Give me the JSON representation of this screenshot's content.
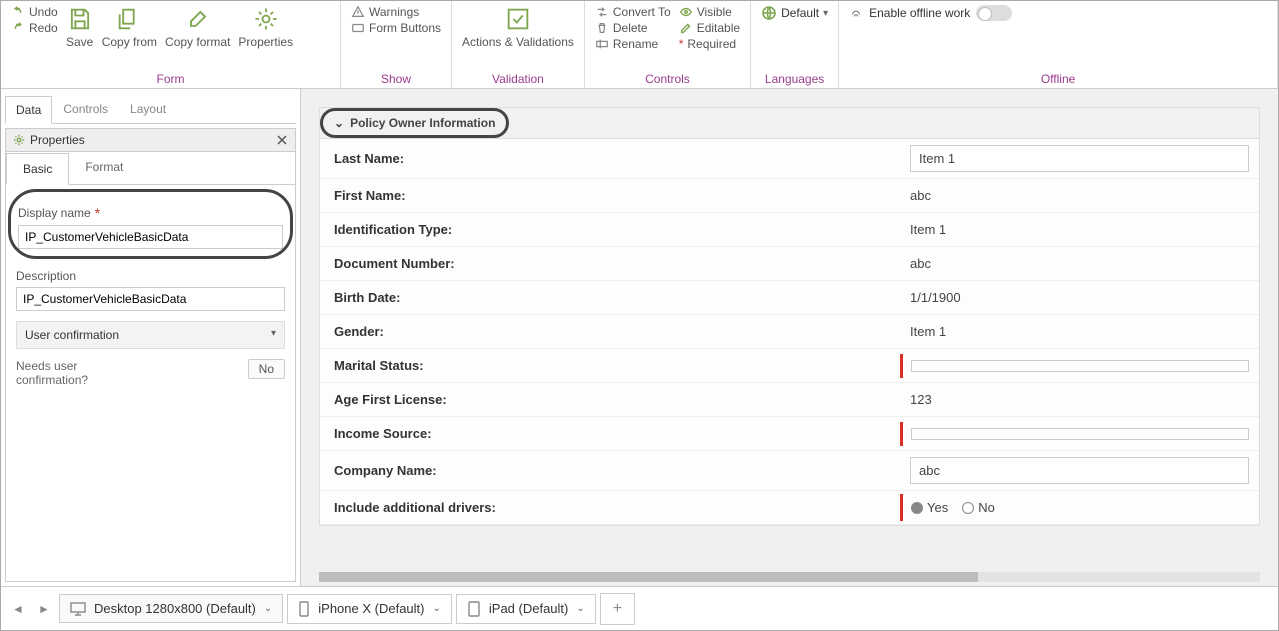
{
  "ribbon": {
    "undo": "Undo",
    "redo": "Redo",
    "save": "Save",
    "copy_from": "Copy from",
    "copy_format": "Copy format",
    "properties": "Properties",
    "warnings": "Warnings",
    "form_buttons": "Form Buttons",
    "actions_validations": "Actions & Validations",
    "convert_to": "Convert To",
    "delete": "Delete",
    "rename": "Rename",
    "visible": "Visible",
    "editable": "Editable",
    "required": "Required",
    "default_lang": "Default",
    "enable_offline": "Enable offline work",
    "groups": {
      "form": "Form",
      "show": "Show",
      "validation": "Validation",
      "controls": "Controls",
      "languages": "Languages",
      "offline": "Offline"
    }
  },
  "left": {
    "tabs": {
      "data": "Data",
      "controls": "Controls",
      "layout": "Layout"
    },
    "properties_title": "Properties",
    "subtabs": {
      "basic": "Basic",
      "format": "Format"
    },
    "display_name_label": "Display name",
    "display_name_value": "IP_CustomerVehicleBasicData",
    "description_label": "Description",
    "description_value": "IP_CustomerVehicleBasicData",
    "user_confirmation": "User confirmation",
    "needs_user_confirmation": "Needs user confirmation?",
    "no": "No"
  },
  "form": {
    "section_title": "Policy Owner Information",
    "rows": [
      {
        "label": "Last Name:",
        "value": "Item 1",
        "boxed": true
      },
      {
        "label": "First Name:",
        "value": "abc"
      },
      {
        "label": "Identification Type:",
        "value": "Item 1"
      },
      {
        "label": "Document Number:",
        "value": "abc"
      },
      {
        "label": "Birth Date:",
        "value": "1/1/1900"
      },
      {
        "label": "Gender:",
        "value": "Item 1"
      },
      {
        "label": "Marital Status:",
        "value": "",
        "boxed": true,
        "redbar": true
      },
      {
        "label": "Age First License:",
        "value": "123"
      },
      {
        "label": "Income Source:",
        "value": "",
        "boxed": true,
        "redbar": true
      },
      {
        "label": "Company Name:",
        "value": "abc",
        "boxed": true
      },
      {
        "label": "Include additional drivers:",
        "radios": true,
        "redbar": true
      }
    ],
    "yes": "Yes",
    "no": "No"
  },
  "footer": {
    "desktop": "Desktop 1280x800 (Default)",
    "iphone": "iPhone X (Default)",
    "ipad": "iPad (Default)"
  }
}
